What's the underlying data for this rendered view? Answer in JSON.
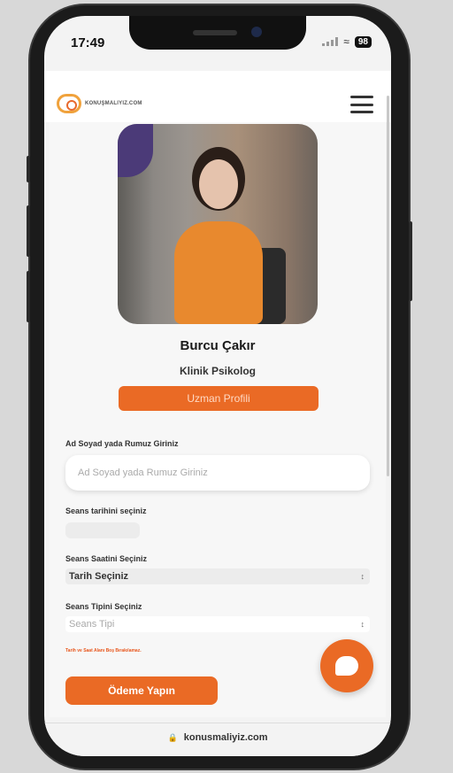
{
  "status_bar": {
    "time": "17:49",
    "battery": "98",
    "wifi_icon": "wifi-icon"
  },
  "header": {
    "logo_text": "KONUŞMALIYIZ.COM",
    "menu_icon": "hamburger-icon"
  },
  "expert": {
    "name": "Burcu Çakır",
    "title": "Klinik Psikolog",
    "profile_button": "Uzman Profili"
  },
  "form": {
    "name_label": "Ad Soyad yada Rumuz Giriniz",
    "name_placeholder": "Ad Soyad yada Rumuz Giriniz",
    "date_label": "Seans tarihini seçiniz",
    "time_label": "Seans Saatini Seçiniz",
    "time_value": "Tarih Seçiniz",
    "type_label": "Seans Tipini Seçiniz",
    "type_value": "Seans Tipi",
    "warning": "Tarih ve Saat Alanı Boş Bırakılamaz.",
    "pay_button": "Ödeme Yapın"
  },
  "browser": {
    "url": "konusmaliyiz.com"
  },
  "colors": {
    "accent": "#ea6a25"
  }
}
